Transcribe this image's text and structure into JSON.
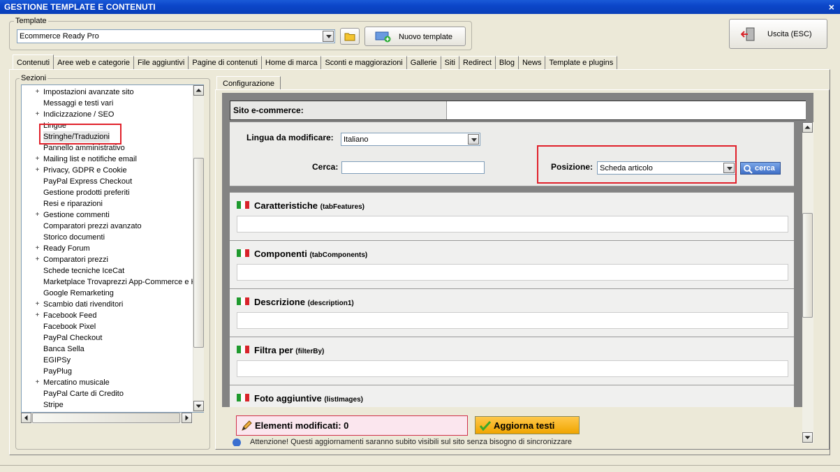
{
  "window": {
    "title": "GESTIONE TEMPLATE E CONTENUTI",
    "close_glyph": "×"
  },
  "template_group": {
    "label": "Template",
    "selected": "Ecommerce Ready Pro",
    "new_template_label": "Nuovo template"
  },
  "exit_button": {
    "label": "Uscita (ESC)"
  },
  "tabs": [
    "Contenuti",
    "Aree web e categorie",
    "File aggiuntivi",
    "Pagine di contenuti",
    "Home di marca",
    "Sconti e maggiorazioni",
    "Gallerie",
    "Siti",
    "Redirect",
    "Blog",
    "News",
    "Template e plugins"
  ],
  "sections_group": {
    "label": "Sezioni",
    "items": [
      {
        "label": "Impostazioni avanzate sito",
        "expandable": true
      },
      {
        "label": "Messaggi e testi vari",
        "expandable": false
      },
      {
        "label": "Indicizzazione / SEO",
        "expandable": true
      },
      {
        "label": "Lingue",
        "expandable": false
      },
      {
        "label": "Stringhe/Traduzioni",
        "expandable": false,
        "selected": true
      },
      {
        "label": "Pannello amministrativo",
        "expandable": false
      },
      {
        "label": "Mailing list e notifiche email",
        "expandable": true
      },
      {
        "label": "Privacy, GDPR e Cookie",
        "expandable": true
      },
      {
        "label": "PayPal Express Checkout",
        "expandable": false
      },
      {
        "label": "Gestione prodotti preferiti",
        "expandable": false
      },
      {
        "label": "Resi e riparazioni",
        "expandable": false
      },
      {
        "label": "Gestione commenti",
        "expandable": true
      },
      {
        "label": "Comparatori prezzi avanzato",
        "expandable": false
      },
      {
        "label": "Storico documenti",
        "expandable": false
      },
      {
        "label": "Ready Forum",
        "expandable": true
      },
      {
        "label": "Comparatori prezzi",
        "expandable": true
      },
      {
        "label": "Schede tecniche IceCat",
        "expandable": false
      },
      {
        "label": "Marketplace Trovaprezzi App-Commerce e Ki",
        "expandable": false
      },
      {
        "label": "Google Remarketing",
        "expandable": false
      },
      {
        "label": "Scambio dati rivenditori",
        "expandable": true
      },
      {
        "label": "Facebook Feed",
        "expandable": true
      },
      {
        "label": "Facebook Pixel",
        "expandable": false
      },
      {
        "label": "PayPal Checkout",
        "expandable": false
      },
      {
        "label": "Banca Sella",
        "expandable": false
      },
      {
        "label": "EGIPSy",
        "expandable": false
      },
      {
        "label": "PayPlug",
        "expandable": false
      },
      {
        "label": "Mercatino musicale",
        "expandable": true
      },
      {
        "label": "PayPal Carte di Credito",
        "expandable": false
      },
      {
        "label": "Stripe",
        "expandable": false
      }
    ]
  },
  "config": {
    "tab_label": "Configurazione",
    "site_label": "Sito e-commerce:",
    "language_label": "Lingua da modificare:",
    "language_value": "Italiano",
    "search_label": "Cerca:",
    "search_value": "",
    "position_label": "Posizione:",
    "position_value": "Scheda articolo",
    "search_button": "cerca",
    "sections": [
      {
        "title": "Caratteristiche",
        "key": "(tabFeatures)"
      },
      {
        "title": "Componenti",
        "key": "(tabComponents)"
      },
      {
        "title": "Descrizione",
        "key": "(description1)"
      },
      {
        "title": "Filtra per",
        "key": "(filterBy)"
      },
      {
        "title": "Foto aggiuntive",
        "key": "(listImages)"
      }
    ],
    "modified_label": "Elementi modificati: 0",
    "update_button": "Aggiorna testi",
    "warning": "Attenzione! Questi aggiornamenti saranno subito visibili sul sito senza bisogno di sincronizzare"
  },
  "colors": {
    "title_bar": "#0b46c9",
    "highlight": "#e0202a",
    "update_button": "#f0a500",
    "flag_green": "#1f9a2e",
    "flag_red": "#d8232a"
  }
}
